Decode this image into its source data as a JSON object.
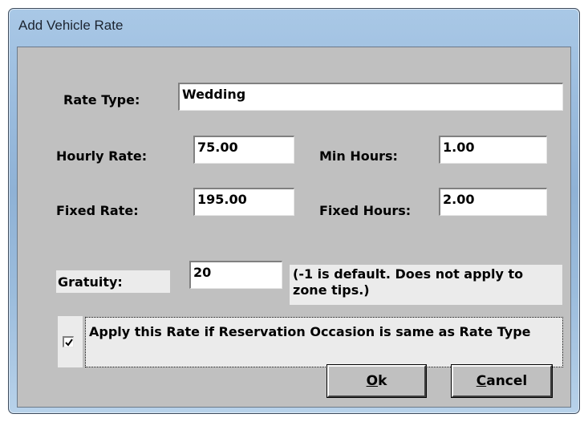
{
  "window": {
    "title": "Add Vehicle Rate"
  },
  "form": {
    "rate_type": {
      "label": "Rate Type:",
      "value": "Wedding"
    },
    "hourly_rate": {
      "label": "Hourly Rate:",
      "value": "75.00"
    },
    "min_hours": {
      "label": "Min Hours:",
      "value": "1.00"
    },
    "fixed_rate": {
      "label": "Fixed Rate:",
      "value": "195.00"
    },
    "fixed_hours": {
      "label": "Fixed Hours:",
      "value": "2.00"
    },
    "gratuity": {
      "label": "Gratuity:",
      "value": "20",
      "note": "(-1 is default. Does not apply to zone tips.)"
    },
    "apply_occasion": {
      "checked": true,
      "label": "Apply this Rate if Reservation Occasion is same as Rate Type"
    }
  },
  "buttons": {
    "ok": {
      "mnemonic": "O",
      "rest": "k"
    },
    "cancel": {
      "mnemonic": "C",
      "rest": "ancel"
    }
  },
  "icons": {
    "checkbox_mark": "checkmark-icon"
  }
}
